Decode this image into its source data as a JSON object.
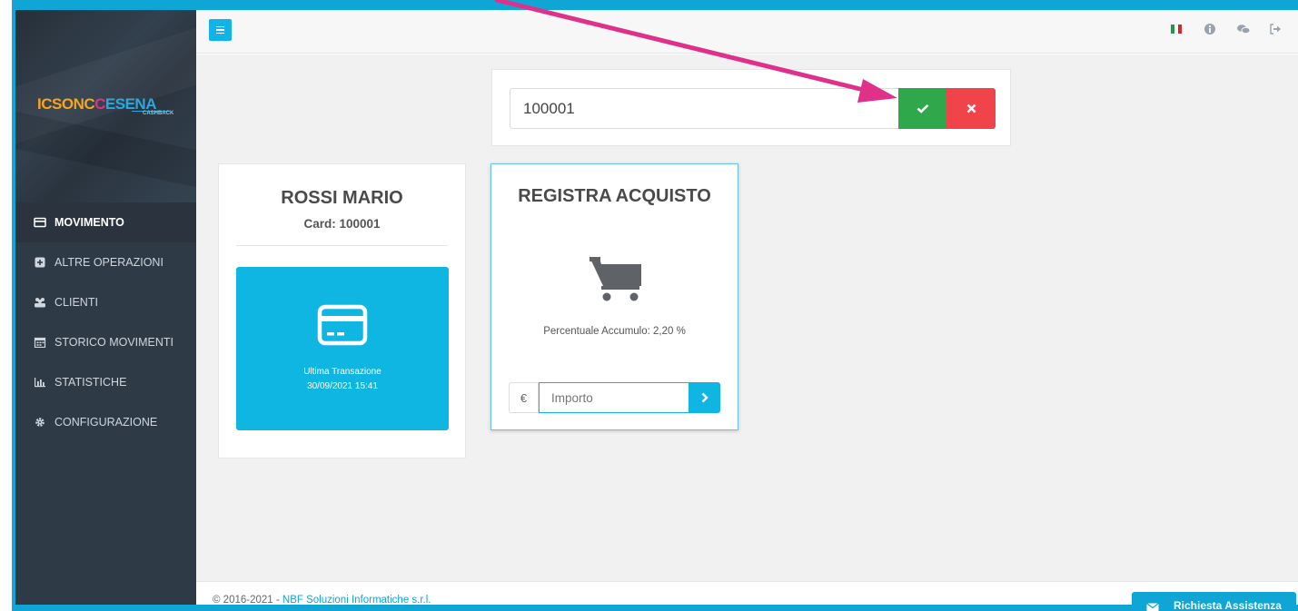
{
  "header": {
    "menu_icon": "hamburger-icon",
    "icons": [
      "italian-flag",
      "info-icon",
      "chat-icon",
      "logout-icon"
    ]
  },
  "sidebar": {
    "logo_main": "ICSONCCESENA",
    "logo_sub": "CASHBACK",
    "items": [
      {
        "label": "MOVIMENTO",
        "icon": "card-icon",
        "active": true
      },
      {
        "label": "ALTRE OPERAZIONI",
        "icon": "plus-square-icon",
        "active": false
      },
      {
        "label": "CLIENTI",
        "icon": "users-icon",
        "active": false
      },
      {
        "label": "STORICO MOVIMENTI",
        "icon": "calendar-icon",
        "active": false
      },
      {
        "label": "STATISTICHE",
        "icon": "bar-chart-icon",
        "active": false
      },
      {
        "label": "CONFIGURAZIONE",
        "icon": "gear-icon",
        "active": false
      }
    ]
  },
  "search": {
    "value": "100001",
    "confirm_icon": "check-icon",
    "cancel_icon": "close-icon"
  },
  "client": {
    "name": "ROSSI MARIO",
    "card_label": "Card: 100001",
    "tile_label": "Ultima Transazione",
    "tile_date": "30/09/2021 15:41",
    "tile_icon": "credit-card-icon"
  },
  "purchase": {
    "title": "REGISTRA ACQUISTO",
    "icon": "shopping-cart-icon",
    "percent_label": "Percentuale Accumulo: 2,20 %",
    "currency": "€",
    "amount_placeholder": "Importo",
    "submit_icon": "chevron-right-icon"
  },
  "footer": {
    "copyright": "© 2016-2021 - ",
    "company": "NBF Soluzioni Informatiche s.r.l."
  },
  "assist": {
    "label": "Richiesta Assistenza",
    "icon": "envelope-icon"
  },
  "colors": {
    "accent": "#0fa6d6",
    "tile": "#0fb6e2",
    "success": "#2ea84a",
    "danger": "#f0434a",
    "sidebar": "#2f3a47",
    "annotation_arrow": "#e0318a"
  }
}
